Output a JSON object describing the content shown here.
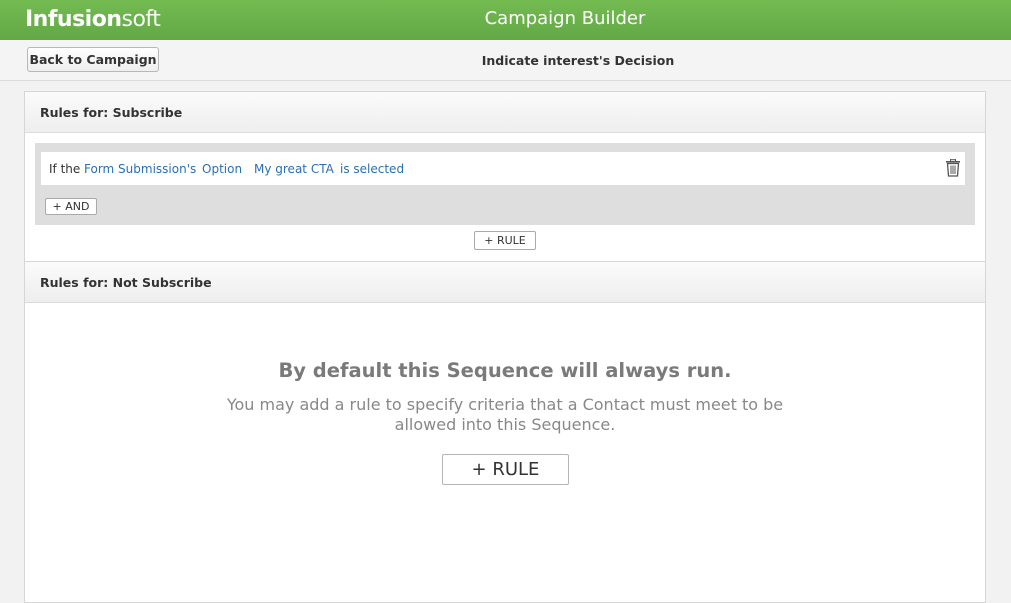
{
  "header": {
    "logo_bold": "Infusion",
    "logo_light": "soft",
    "app_title": "Campaign Builder"
  },
  "subbar": {
    "back_label": "Back to Campaign",
    "decision_title": "Indicate interest's Decision"
  },
  "panels": [
    {
      "title": "Rules for: Subscribe",
      "rule": {
        "prefix": "If the",
        "source": "Form Submission's",
        "field": "Option",
        "value": "My great CTA",
        "condition": "is selected"
      },
      "and_label": "+ AND",
      "rule_label": "+ RULE"
    },
    {
      "title": "Rules for: Not Subscribe",
      "default_heading": "By default this Sequence will always run.",
      "default_text": "You may add a rule to specify criteria that a Contact must meet to be allowed into this Sequence.",
      "rule_label": "+ RULE"
    }
  ],
  "icons": {
    "delete_rule": "trash-icon"
  },
  "colors": {
    "brand_green": "#6ab04c",
    "link_blue": "#2a6fb5"
  }
}
